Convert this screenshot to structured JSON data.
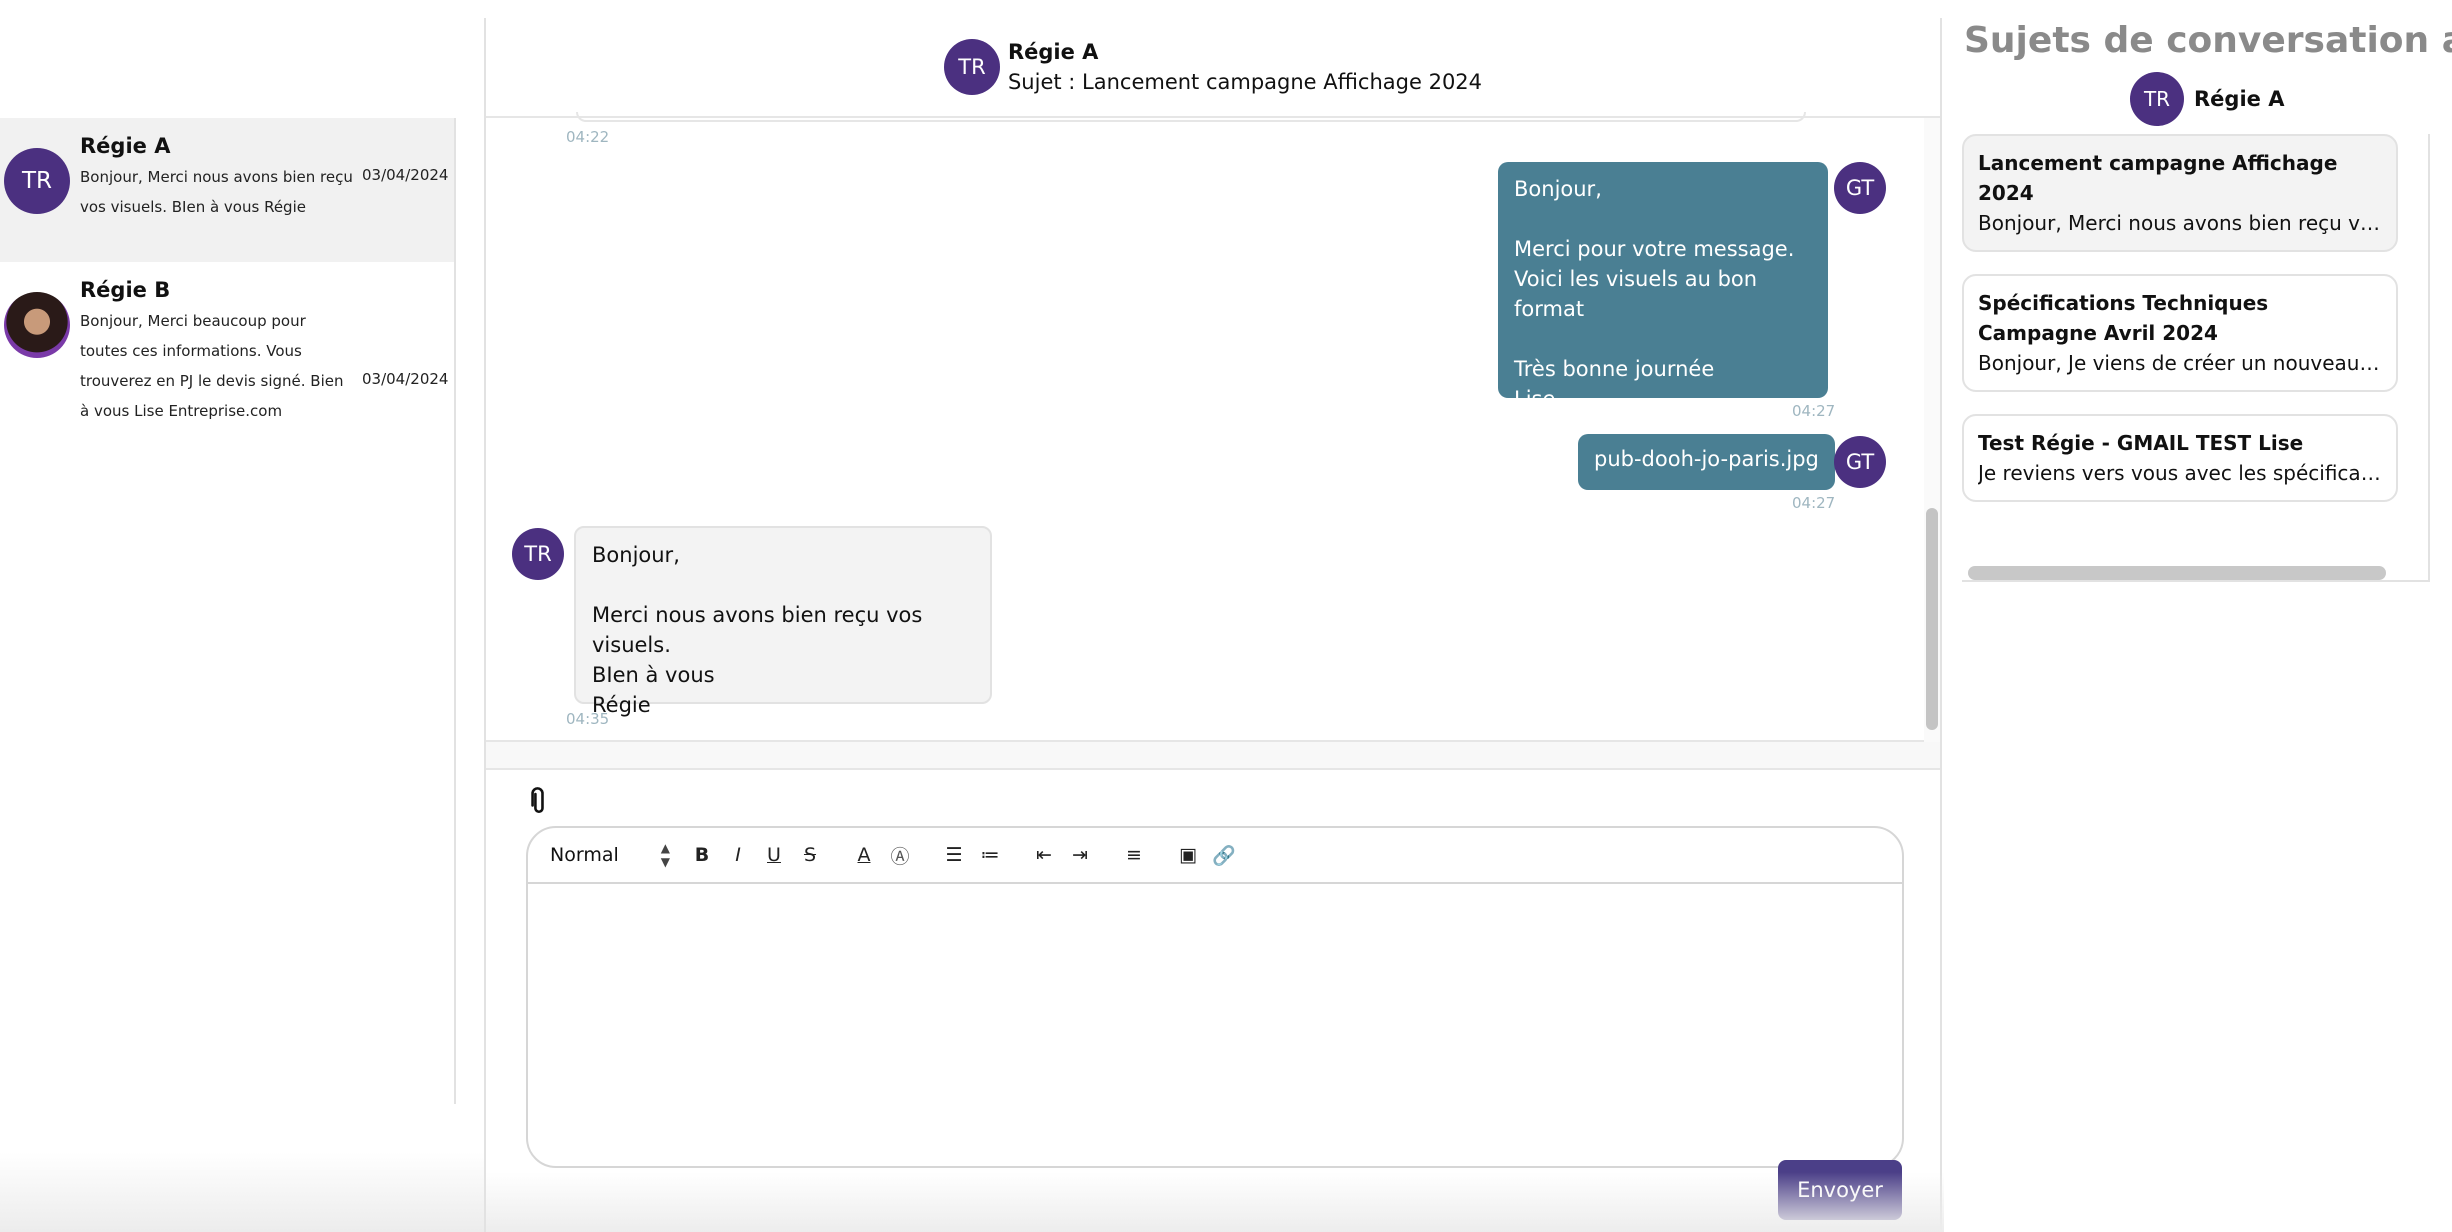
{
  "conversations": [
    {
      "name": "Régie A",
      "avatar": "TR",
      "preview": "Bonjour, Merci nous avons bien reçu vos visuels. BIen à vous Régie",
      "date": "03/04/2024"
    },
    {
      "name": "Régie B",
      "avatar": "photo",
      "preview": "Bonjour, Merci beaucoup pour toutes ces informations. Vous trouverez en PJ le devis signé. Bien à vous Lise Entreprise.com",
      "date": "03/04/2024"
    }
  ],
  "chat": {
    "contact": "Régie A",
    "avatar": "TR",
    "subject": "Sujet : Lancement campagne Affichage 2024",
    "messages": [
      {
        "time": "04:22"
      },
      {
        "from": "me",
        "avatar": "GT",
        "lines": [
          "Bonjour,",
          "",
          "Merci pour votre message.",
          "Voici les visuels au bon format",
          "",
          "Très bonne journée",
          "Lise"
        ],
        "time": "04:27"
      },
      {
        "from": "me",
        "avatar": "GT",
        "lines": [
          "pub-dooh-jo-paris.jpg"
        ],
        "time": "04:27"
      },
      {
        "from": "them",
        "avatar": "TR",
        "lines": [
          "Bonjour,",
          "",
          "Merci nous avons bien reçu vos visuels.",
          "BIen à vous",
          "Régie"
        ],
        "time": "04:35"
      }
    ]
  },
  "composer": {
    "attach_icon": "paperclip-icon",
    "format": "Normal",
    "toolbar_icons": [
      "bold-icon",
      "italic-icon",
      "underline-icon",
      "strike-icon",
      "text-color-icon",
      "highlight-icon",
      "ordered-list-icon",
      "bullet-list-icon",
      "outdent-icon",
      "indent-icon",
      "align-icon",
      "image-icon",
      "link-icon"
    ],
    "send_label": "Envoyer"
  },
  "topics_panel": {
    "title": "Sujets de conversation avec",
    "contact": "Régie A",
    "avatar": "TR",
    "topics": [
      {
        "title": "Lancement campagne Affichage 2024",
        "preview": "Bonjour, Merci nous avons bien reçu vos visuels. BIen à vous Régie"
      },
      {
        "title": "Spécifications Techniques Campagne Avril 2024",
        "preview": "Bonjour, Je viens de créer un nouveau sujet"
      },
      {
        "title": "Test Régie - GMAIL TEST Lise",
        "preview": "Je reviens vers vous avec les spécifications"
      }
    ]
  },
  "colors": {
    "brand": "#4b3080",
    "outgoing": "#4a7f93",
    "send": "#4b3f88"
  }
}
